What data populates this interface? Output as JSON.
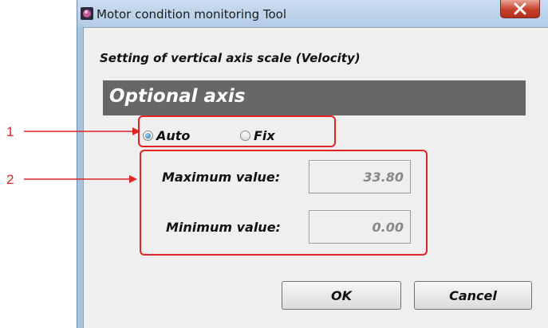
{
  "window": {
    "title": "Motor condition monitoring Tool",
    "close_symbol": "X"
  },
  "dialog": {
    "setting_title": "Setting of vertical axis scale (Velocity)",
    "section_title": "Optional axis",
    "radio_options": [
      {
        "label": "Auto",
        "checked": true
      },
      {
        "label": "Fix",
        "checked": false
      }
    ],
    "fields": [
      {
        "label": "Maximum value:",
        "value": "33.80"
      },
      {
        "label": "Minimum value:",
        "value": "0.00"
      }
    ],
    "buttons": {
      "ok": "OK",
      "cancel": "Cancel"
    }
  },
  "annotations": [
    {
      "number": "1"
    },
    {
      "number": "2"
    }
  ],
  "colors": {
    "annotation": "#e02424",
    "section_header": "#676767",
    "window_frame": "#a8c4e0"
  }
}
